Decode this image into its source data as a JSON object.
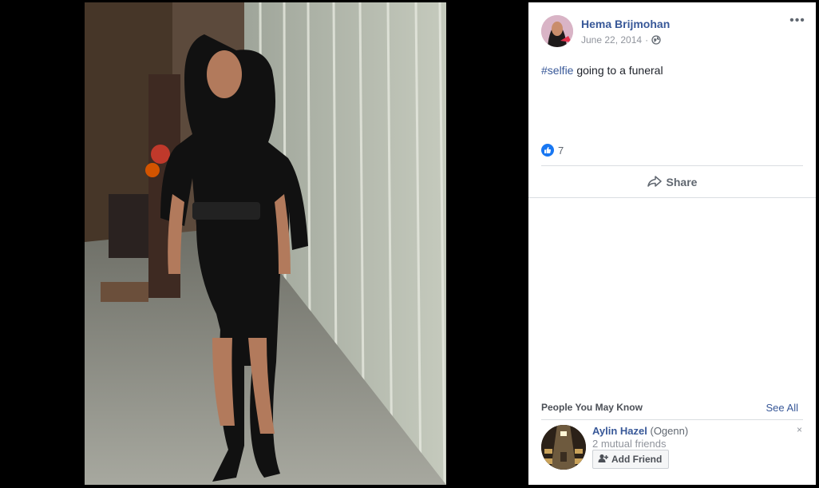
{
  "post": {
    "author": "Hema Brijmohan",
    "date": "June 22, 2014",
    "separator": "·",
    "hashtag": "#selfie",
    "text": " going to a funeral",
    "like_count": "7",
    "share_label": "Share",
    "more_label": "•••"
  },
  "pymk": {
    "title": "People You May Know",
    "see_all": "See All",
    "suggestion": {
      "name": "Aylin Hazel",
      "alt_name": " (Ogenn)",
      "mutual": "2 mutual friends",
      "add_label": "Add Friend",
      "dismiss": "×"
    }
  },
  "colors": {
    "link": "#385898",
    "like": "#1877f2",
    "divider": "#dadde1"
  },
  "icons": [
    "globe-icon",
    "like-icon",
    "share-icon",
    "add-friend-icon",
    "close-icon",
    "more-icon"
  ]
}
